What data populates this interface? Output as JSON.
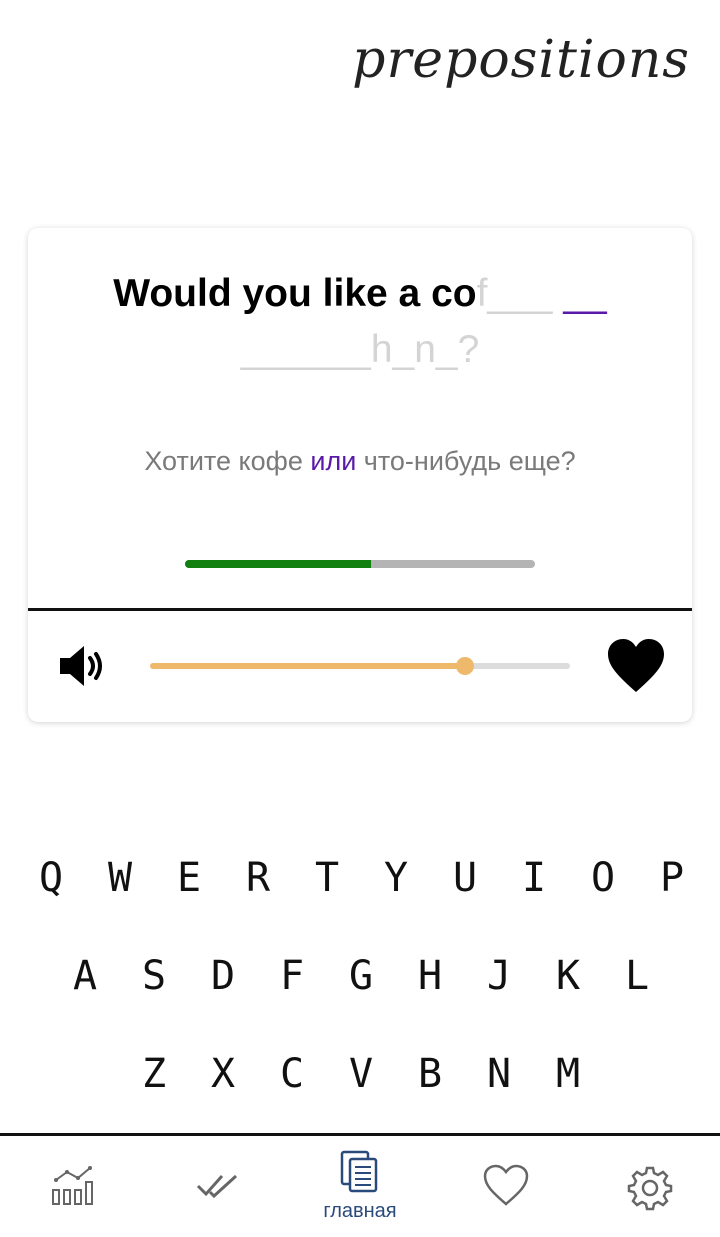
{
  "app": {
    "title": "prepositions"
  },
  "card": {
    "sentence_typed": "Would you like a co",
    "sentence_hint_line1": "f___ ",
    "sentence_cursor": "__",
    "sentence_hint_line2": "______h_n_?",
    "translation_pre": "Хотите кофе ",
    "translation_highlight": "или",
    "translation_post": " что-нибудь еще?",
    "progress_fraction": 0.53,
    "audio_position_fraction": 0.75,
    "colors": {
      "progress": "#118011",
      "progress_track": "#b4b4b4",
      "slider": "#efb96c",
      "highlight": "#5a1aa8",
      "hint": "#d4d4d4"
    },
    "icons": {
      "speaker": "speaker-icon",
      "favorite": "heart-filled-icon"
    }
  },
  "keyboard": {
    "rows": [
      [
        "Q",
        "W",
        "E",
        "R",
        "T",
        "Y",
        "U",
        "I",
        "O",
        "P"
      ],
      [
        "A",
        "S",
        "D",
        "F",
        "G",
        "H",
        "J",
        "K",
        "L"
      ],
      [
        "Z",
        "X",
        "C",
        "V",
        "B",
        "N",
        "M"
      ]
    ]
  },
  "bottom_nav": {
    "items": [
      {
        "icon": "stats-chart-icon",
        "label": ""
      },
      {
        "icon": "double-check-icon",
        "label": ""
      },
      {
        "icon": "pages-icon",
        "label": "главная",
        "active": true
      },
      {
        "icon": "heart-outline-icon",
        "label": ""
      },
      {
        "icon": "gear-icon",
        "label": ""
      }
    ]
  }
}
